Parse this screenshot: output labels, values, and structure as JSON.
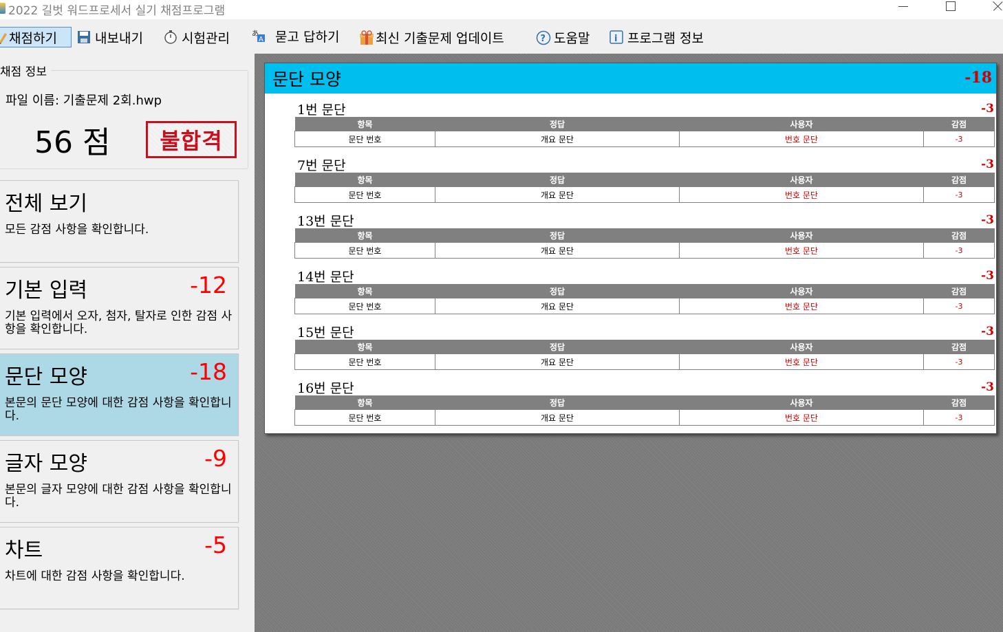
{
  "window": {
    "title": "2022 길벗 워드프로세서 실기 채점프로그램"
  },
  "toolbar": {
    "items": [
      {
        "label": "채점하기",
        "icon": "pencil-icon",
        "active": true
      },
      {
        "label": "내보내기",
        "icon": "floppy-disk-icon"
      },
      {
        "label": "시험관리",
        "icon": "stopwatch-icon"
      },
      {
        "label": "묻고 답하기",
        "icon": "translate-icon"
      },
      {
        "label": "최신 기출문제 업데이트",
        "icon": "gift-icon"
      },
      {
        "label": "도움말",
        "icon": "help-icon"
      },
      {
        "label": "프로그램 정보",
        "icon": "info-icon"
      }
    ]
  },
  "score_info": {
    "group_label": "채점 정보",
    "file_name": "파일 이름: 기출문제 2회.hwp",
    "score": "56 점",
    "result_stamp": "불합격"
  },
  "categories": [
    {
      "title": "전체 보기",
      "score": "",
      "desc": "모든 감점 사항을 확인합니다."
    },
    {
      "title": "기본 입력",
      "score": "-12",
      "desc": "기본 입력에서 오자, 첨자, 탈자로 인한 감점 사항을 확인합니다."
    },
    {
      "title": "문단 모양",
      "score": "-18",
      "desc": "본문의 문단 모양에 대한 감점 사항을 확인합니다.",
      "selected": true
    },
    {
      "title": "글자 모양",
      "score": "-9",
      "desc": "본문의 글자 모양에 대한 감점 사항을 확인합니다."
    },
    {
      "title": "차트",
      "score": "-5",
      "desc": "차트에 대한 감점 사항을 확인합니다."
    }
  ],
  "detail": {
    "title": "문단 모양",
    "total": "-18",
    "columns": [
      "항목",
      "정답",
      "사용자",
      "감점"
    ],
    "sections": [
      {
        "title": "1번 문단",
        "score": "-3",
        "row": [
          "문단 번호",
          "개요 문단",
          "번호 문단",
          "-3"
        ]
      },
      {
        "title": "7번 문단",
        "score": "-3",
        "row": [
          "문단 번호",
          "개요 문단",
          "번호 문단",
          "-3"
        ]
      },
      {
        "title": "13번 문단",
        "score": "-3",
        "row": [
          "문단 번호",
          "개요 문단",
          "번호 문단",
          "-3"
        ]
      },
      {
        "title": "14번 문단",
        "score": "-3",
        "row": [
          "문단 번호",
          "개요 문단",
          "번호 문단",
          "-3"
        ]
      },
      {
        "title": "15번 문단",
        "score": "-3",
        "row": [
          "문단 번호",
          "개요 문단",
          "번호 문단",
          "-3"
        ]
      },
      {
        "title": "16번 문단",
        "score": "-3",
        "row": [
          "문단 번호",
          "개요 문단",
          "번호 문단",
          "-3"
        ]
      }
    ]
  },
  "colors": {
    "header_bg": "#00bfef",
    "selected_card": "#add8e6",
    "penalty": "#d00000"
  }
}
